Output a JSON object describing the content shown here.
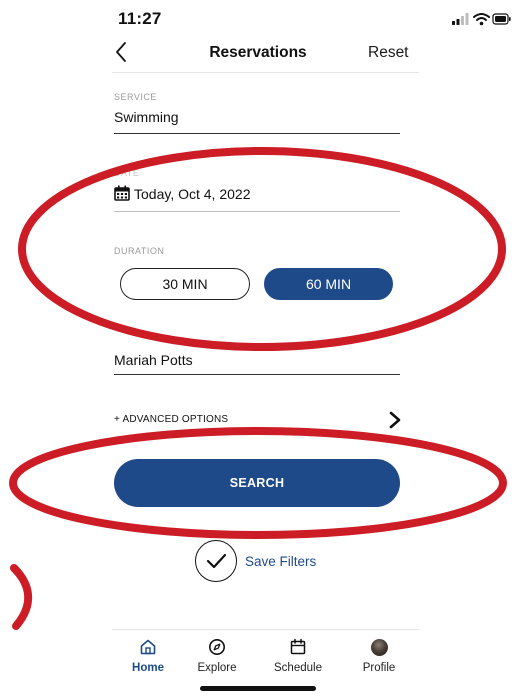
{
  "status_bar": {
    "time": "11:27",
    "icons": [
      "cellular-signal-icon",
      "wifi-icon",
      "battery-icon"
    ]
  },
  "header": {
    "back_icon": "chevron-left-icon",
    "title": "Reservations",
    "reset_label": "Reset"
  },
  "form": {
    "service": {
      "label": "SERVICE",
      "value": "Swimming"
    },
    "date": {
      "label": "DATE",
      "value": "Today, Oct 4, 2022",
      "icon": "calendar-icon"
    },
    "duration": {
      "label": "DURATION",
      "options": [
        {
          "label": "30 MIN",
          "selected": false
        },
        {
          "label": "60 MIN",
          "selected": true
        }
      ]
    },
    "person": {
      "value": "Mariah Potts"
    },
    "advanced_label": "+ ADVANCED OPTIONS",
    "search_label": "SEARCH",
    "save_filters_label": "Save Filters"
  },
  "tab_bar": {
    "tabs": [
      {
        "label": "Home",
        "icon": "home-icon",
        "active": true
      },
      {
        "label": "Explore",
        "icon": "compass-icon",
        "active": false
      },
      {
        "label": "Schedule",
        "icon": "calendar-icon",
        "active": false
      },
      {
        "label": "Profile",
        "icon": "avatar",
        "active": false
      }
    ]
  },
  "colors": {
    "accent": "#1f4a89",
    "annotation": "#cc1c25",
    "label_gray": "#9a9a9a"
  }
}
